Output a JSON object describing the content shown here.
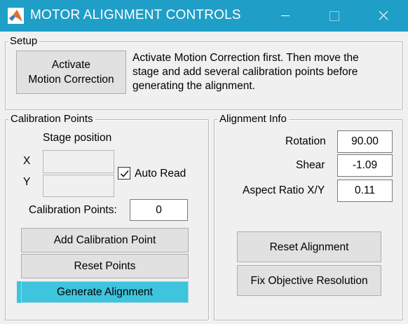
{
  "window": {
    "title": "MOTOR ALIGNMENT CONTROLS",
    "icons": [
      "matlab-logo-icon",
      "minimize-icon",
      "maximize-icon",
      "close-icon"
    ]
  },
  "setup": {
    "title": "Setup",
    "activate_button": [
      "Activate",
      "Motion Correction"
    ],
    "description": [
      "Activate Motion Correction first. Then move the",
      "stage and add several calibration points before",
      "generating the alignment."
    ]
  },
  "calibration": {
    "title": "Calibration Points",
    "stage_position_label": "Stage position",
    "x_label": "X",
    "y_label": "Y",
    "x_value": "",
    "y_value": "",
    "auto_read_label": "Auto Read",
    "auto_read_checked": true,
    "count_label": "Calibration Points:",
    "count_value": "0",
    "add_button": "Add Calibration Point",
    "reset_button": "Reset Points",
    "generate_button": "Generate Alignment",
    "highlight_color": "#3ec4dc"
  },
  "alignment": {
    "title": "Alignment Info",
    "rotation_label": "Rotation",
    "rotation_value": "90.00",
    "shear_label": "Shear",
    "shear_value": "-1.09",
    "aspect_label": "Aspect Ratio X/Y",
    "aspect_value": "0.11",
    "reset_button": "Reset Alignment",
    "fix_button": "Fix Objective Resolution"
  },
  "colors": {
    "titlebar": "#1f9ec8",
    "window_bg": "#f0f0f0",
    "button_bg": "#e1e1e1"
  }
}
